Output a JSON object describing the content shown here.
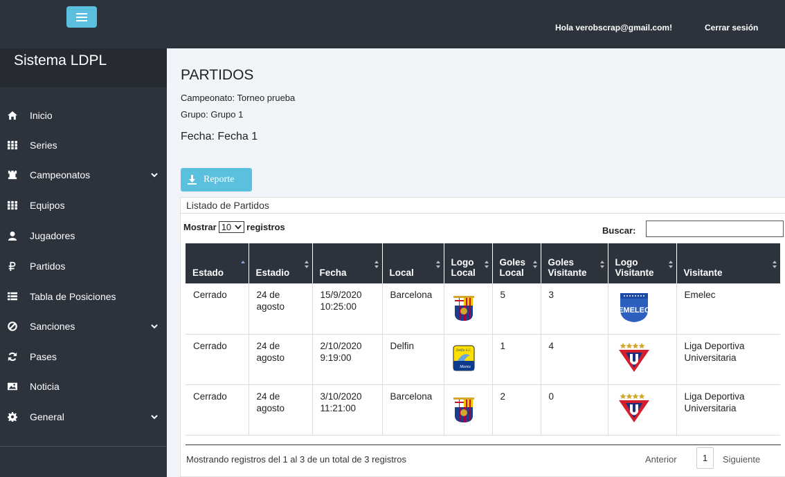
{
  "header": {
    "greeting": "Hola verobscrap@gmail.com!",
    "logout": "Cerrar sesión"
  },
  "sidebar": {
    "brand": "Sistema LDPL",
    "items": [
      {
        "label": "Inicio",
        "icon": "home-icon"
      },
      {
        "label": "Series",
        "icon": "grid-icon"
      },
      {
        "label": "Campeonatos",
        "icon": "rook-icon",
        "expandable": true
      },
      {
        "label": "Equipos",
        "icon": "grid-icon"
      },
      {
        "label": "Jugadores",
        "icon": "user-icon"
      },
      {
        "label": "Partidos",
        "icon": "ruble-icon"
      },
      {
        "label": "Tabla de Posiciones",
        "icon": "list-icon"
      },
      {
        "label": "Sanciones",
        "icon": "ban-icon",
        "expandable": true
      },
      {
        "label": "Pases",
        "icon": "refresh-icon"
      },
      {
        "label": "Noticia",
        "icon": "picture-icon"
      },
      {
        "label": "General",
        "icon": "gear-icon",
        "expandable": true
      }
    ]
  },
  "page": {
    "title": "PARTIDOS",
    "campeonato": "Campeonato: Torneo prueba",
    "grupo": "Grupo: Grupo 1",
    "fecha": "Fecha: Fecha 1",
    "report_button": "Reporte"
  },
  "panel": {
    "heading": "Listado de Partidos",
    "show_prefix": "Mostrar",
    "show_value": "10",
    "show_suffix": "registros",
    "search_label": "Buscar:",
    "search_value": ""
  },
  "table": {
    "columns": [
      "Estado",
      "Estadio",
      "Fecha",
      "Local",
      "Logo Local",
      "Goles Local",
      "Goles Visitante",
      "Logo Visitante",
      "Visitante"
    ],
    "rows": [
      {
        "estado": "Cerrado",
        "estadio": "24 de agosto",
        "fecha": "15/9/2020 10:25:00",
        "local": "Barcelona",
        "logo_local": "barcelona",
        "goles_local": "5",
        "goles_visitante": "3",
        "logo_visitante": "emelec",
        "visitante": "Emelec"
      },
      {
        "estado": "Cerrado",
        "estadio": "24 de agosto",
        "fecha": "2/10/2020 9:19:00",
        "local": "Delfin",
        "logo_local": "delfin",
        "goles_local": "1",
        "goles_visitante": "4",
        "logo_visitante": "ldu",
        "visitante": "Liga Deportiva Universitaria"
      },
      {
        "estado": "Cerrado",
        "estadio": "24 de agosto",
        "fecha": "3/10/2020 11:21:00",
        "local": "Barcelona",
        "logo_local": "barcelona",
        "goles_local": "2",
        "goles_visitante": "0",
        "logo_visitante": "ldu",
        "visitante": "Liga Deportiva Universitaria"
      }
    ],
    "logo_text": {
      "delfin_top": "Delfin S.C.",
      "delfin_bottom": "Manta",
      "emelec": "EMELEC"
    }
  },
  "footer": {
    "info": "Mostrando registros del 1 al 3 de un total de 3 registros",
    "prev": "Anterior",
    "page": "1",
    "next": "Siguiente"
  },
  "colors": {
    "dark": "#2d333d",
    "accent": "#5bc0de"
  }
}
